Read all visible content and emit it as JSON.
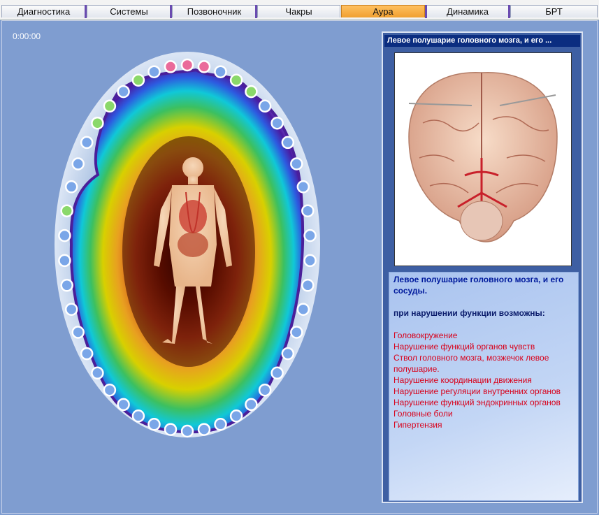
{
  "tabs": [
    {
      "label": "Диагностика",
      "active": false
    },
    {
      "label": "Системы",
      "active": false
    },
    {
      "label": "Позвоночник",
      "active": false
    },
    {
      "label": "Чакры",
      "active": false
    },
    {
      "label": "Аура",
      "active": true
    },
    {
      "label": "Динамика",
      "active": false
    },
    {
      "label": "БРТ",
      "active": false
    }
  ],
  "timer": "0:00:00",
  "aura": {
    "colors": {
      "active_tab": "#f0a030",
      "point_normal": "#7aa6e8",
      "point_pink": "#ea6a9a",
      "point_green": "#8ad86a",
      "background": "#7f9dd0"
    }
  },
  "panel": {
    "title": "Левое полушарие головного мозга, и его ...",
    "image_icon": "brain-illustration",
    "heading": "Левое полушарие головного мозга, и его сосуды.",
    "subheading": "при нарушении функции возможны:",
    "symptoms": [
      "Головокружение",
      "Нарушение функций органов чувств",
      "Ствол головного мозга, мозжечок левое полушарие.",
      "Нарушение координации движения",
      "Нарушение регуляции внутренних органов",
      "Нарушение функций эндокринных органов",
      "Головные боли",
      "Гипертензия"
    ]
  }
}
